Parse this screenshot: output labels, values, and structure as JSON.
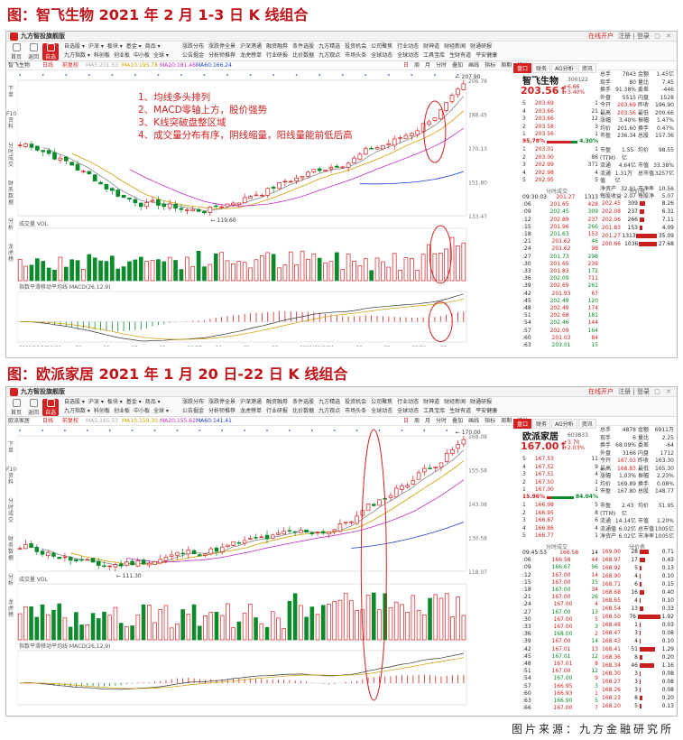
{
  "figures": [
    {
      "title": "图：智飞生物 2021 年 2 月 1-3 日 K 线组合",
      "app": {
        "name": "九方智投旗舰版",
        "open_account": "在线开户",
        "user": "注册 | 登录"
      },
      "toolbar": {
        "buttons": [
          "首页",
          "返回",
          "自选"
        ],
        "menus1": [
          "自选股 ▾",
          "沪深 ▾",
          "板块 ▾",
          "基金 ▾",
          "商品 ▾"
        ],
        "menus2": [
          "九方指数 ▾",
          "科创板",
          "创业板",
          "中小板",
          "全球 ▾"
        ],
        "menus3a": [
          "涨跌分布",
          "涨跌停全景",
          "沪深港通",
          "融资融券",
          "条件选股",
          "九方精选",
          "投资机会",
          "公司聚焦",
          "行业动态",
          "财神道",
          "财经新闻",
          "财通研报"
        ],
        "menus3b": [
          "公告掘金",
          "分析师推荐",
          "龙虎榜单",
          "行业研报",
          "比价数据",
          "九方观点",
          "市场头条",
          "全球动态",
          "全球动态",
          "工具宝库",
          "生财有道",
          "平安健康"
        ]
      },
      "chartbar": {
        "name": "智飞生物",
        "period": "日线",
        "adjust": "前复权",
        "ma_text": "MA5:201.53",
        "ma10": "MA10:195.78",
        "ma20": "MA20:181.46",
        "ma60": "MA60:166.24",
        "tabs": [
          "日",
          "周",
          "月",
          "分时"
        ],
        "buttons": [
          "叠加",
          "画线",
          "指标",
          "周期",
          "统计"
        ]
      },
      "left_tabs": [
        "下单",
        "F10资料",
        "分时成交",
        "财务数据",
        "分析",
        "龙虎榜"
      ],
      "stock": {
        "name": "智飞生物",
        "code": "300122",
        "price": "203.56",
        "arrow": "↑",
        "change": "+6.66",
        "pct": "+3.40%"
      },
      "info": [
        [
          "总手",
          "7843",
          "金额",
          "1.45亿"
        ],
        [
          "现手",
          "80",
          "量比",
          "7.45"
        ],
        [
          "换手",
          "91.38%",
          "委差",
          "-446"
        ],
        [
          "外盘",
          "5515",
          "内盘",
          "1528"
        ],
        [
          "今开",
          "203.69",
          "昨收",
          "196.90"
        ],
        [
          "最高",
          "203.56",
          "最低",
          "200.66"
        ],
        [
          "涨幅",
          "3.40%",
          "振幅",
          "1.47%"
        ],
        [
          "均价",
          "201.60",
          "换手",
          "0.47%"
        ],
        [
          "市盈",
          "236.34",
          "总股",
          "157.36"
        ]
      ],
      "info2": [
        [
          "市盈(TTM)",
          "1.55亿",
          "均价",
          "98.55"
        ],
        [
          "流通",
          "4.64亿",
          "市值",
          "33.38%"
        ],
        [
          "流通值",
          "1.31万亿",
          "总市值",
          "3257亿"
        ],
        [
          "净资产",
          "32.91",
          "市净率",
          "10.56"
        ],
        [
          "每股收益",
          "2.07",
          "每股净",
          "5.07"
        ]
      ],
      "asks": [
        [
          "5",
          "203.69",
          "1"
        ],
        [
          "4",
          "203.66",
          "21"
        ],
        [
          "3",
          "203.66",
          "12"
        ],
        [
          "2",
          "203.58",
          "3"
        ],
        [
          "1",
          "203.56",
          "1"
        ]
      ],
      "depth": {
        "left": "95.78%",
        "right": "4.30%"
      },
      "bids": [
        [
          "1",
          "203.01",
          "1"
        ],
        [
          "2",
          "203.00",
          "86"
        ],
        [
          "3",
          "202.99",
          "371"
        ],
        [
          "4",
          "202.98",
          "4"
        ],
        [
          "5",
          "202.95",
          "5"
        ]
      ],
      "tape_header": {
        "time": "09:30:03",
        "price": "201.27",
        "vol": "1313"
      },
      "tape": [
        [
          "201.65",
          "428"
        ],
        [
          "202.45",
          "309"
        ],
        [
          "202.89",
          "237"
        ],
        [
          "201.96",
          "266"
        ],
        [
          "201.63",
          "153"
        ],
        [
          "201.62",
          "46"
        ],
        [
          "201.62",
          "98"
        ],
        [
          "201.73",
          "298"
        ],
        [
          "201.65",
          "239"
        ],
        [
          "201.83",
          "172"
        ],
        [
          "202.09",
          "711"
        ],
        [
          "202.69",
          "261"
        ],
        [
          "201.93",
          "67"
        ],
        [
          "202.49",
          "120"
        ],
        [
          "202.49",
          "174"
        ],
        [
          "202.68",
          "181"
        ],
        [
          "202.46",
          "144"
        ],
        [
          "202.09",
          "164"
        ],
        [
          "201.03",
          "84"
        ],
        [
          "203.01",
          "15"
        ]
      ],
      "flow": [
        [
          "202.45",
          "309",
          "8.26"
        ],
        [
          "202.08",
          "237",
          "6.31"
        ],
        [
          "202.06",
          "266",
          "7.11"
        ],
        [
          "201.83",
          "153",
          "4.09"
        ],
        [
          "201.27",
          "1313",
          "35.09"
        ],
        [
          "200.66",
          "1036",
          "27.68"
        ]
      ],
      "annotations": [
        "1、均线多头排列",
        "2、MACD零轴上方，股价强势",
        "3、K线突破盘整区域",
        "4、成交量分布有序，阴线缩量，阳线量能前低后高"
      ],
      "price_labels": {
        "high": "207.90",
        "low": "119.60"
      },
      "vol_label": "成交量 VOL",
      "macd_label": "指数平滑移动平均线 MACD(26,12,9)",
      "dates": [
        "2020/10/19",
        "11/02",
        "09",
        "16",
        "23",
        "30",
        "12/07",
        "14",
        "21",
        "28",
        "2021/01/04",
        "11",
        "18",
        "25",
        "02/01",
        "08"
      ]
    },
    {
      "title": "图：欧派家居 2021 年 1 月 20 日-22 日 K 线组合",
      "app": {
        "name": "九方智投旗舰版",
        "open_account": "在线开户",
        "user": "注册 | 登录"
      },
      "chartbar": {
        "name": "欧派家居",
        "period": "日线",
        "adjust": "前复权",
        "ma_text": "MA5:165.53",
        "ma10": "MA10:159.30",
        "ma20": "MA20:155.62",
        "ma60": "MA60:141.41",
        "tabs": [
          "日",
          "周",
          "月",
          "分时"
        ],
        "buttons": [
          "叠加",
          "画线",
          "指标",
          "周期",
          "统计"
        ]
      },
      "stock": {
        "name": "欧派家居",
        "code": "603833",
        "price": "167.00",
        "arrow": "↑",
        "change": "+3.70",
        "pct": "+2.03%"
      },
      "info": [
        [
          "总手",
          "4878",
          "金额",
          "6911万"
        ],
        [
          "现手",
          "6",
          "量比",
          "2.25"
        ],
        [
          "换手",
          "68.09%",
          "委差",
          "-64"
        ],
        [
          "外盘",
          "3166",
          "内盘",
          "1712"
        ],
        [
          "今开",
          "167.03",
          "昨收",
          "163.30"
        ],
        [
          "最高",
          "168.83",
          "最低",
          "165.30"
        ],
        [
          "涨幅",
          "1.03%",
          "振幅",
          "2.23%"
        ],
        [
          "均价",
          "169.89",
          "换手",
          "0.08%"
        ],
        [
          "市盈",
          "167.80",
          "总股",
          "148.77"
        ]
      ],
      "info2": [
        [
          "市盈(TTM)",
          "2.43亿",
          "均价",
          "51.95"
        ],
        [
          "流通",
          "14.14亿",
          "市值",
          "1.20%"
        ],
        [
          "流通值",
          "6.02亿",
          "总市值",
          "1005亿"
        ],
        [
          "净资产",
          "6.02亿",
          "市净率",
          "1005亿"
        ]
      ],
      "asks": [
        [
          "5",
          "167.53",
          "11"
        ],
        [
          "4",
          "167.52",
          "9"
        ],
        [
          "3",
          "167.51",
          "4"
        ],
        [
          "2",
          "167.50",
          "1"
        ],
        [
          "1",
          "167.00",
          "1"
        ]
      ],
      "depth": {
        "left": "15.96%",
        "right": "84.04%"
      },
      "bids": [
        [
          "1",
          "166.98",
          "5"
        ],
        [
          "2",
          "166.95",
          "8"
        ],
        [
          "3",
          "166.87",
          "6"
        ],
        [
          "4",
          "166.86",
          "4"
        ],
        [
          "5",
          "166.77",
          "1"
        ]
      ],
      "tape_header": {
        "time": "09:45:53",
        "price": "166.58",
        "vol": "14"
      },
      "tape": [
        [
          "166.58",
          "44"
        ],
        [
          "166.67",
          "96"
        ],
        [
          "167.00",
          "14"
        ],
        [
          "167.00",
          "15"
        ],
        [
          "167.00",
          "34"
        ],
        [
          "167.00",
          "26"
        ],
        [
          "167.00",
          "4"
        ],
        [
          "167.00",
          "13"
        ],
        [
          "167.00",
          "5"
        ],
        [
          "167.00",
          "3"
        ],
        [
          "168.00",
          "2"
        ],
        [
          "167.00",
          "14"
        ],
        [
          "167.01",
          "13"
        ],
        [
          "167.01",
          "12"
        ],
        [
          "167.01",
          "8"
        ],
        [
          "167.00",
          "12"
        ],
        [
          "167.00",
          "9"
        ],
        [
          "166.95",
          "3"
        ],
        [
          "166.93",
          "1"
        ],
        [
          "166.90",
          "5"
        ],
        [
          "167.00",
          "7"
        ]
      ],
      "flow": [
        [
          "169.00",
          "28",
          "0.71"
        ],
        [
          "168.97",
          "17",
          "0.43"
        ],
        [
          "168.92",
          "5",
          "0.13"
        ],
        [
          "168.90",
          "4",
          "0.10"
        ],
        [
          "168.71",
          "6",
          "0.15"
        ],
        [
          "168.68",
          "16",
          "0.40"
        ],
        [
          "168.65",
          "4",
          "0.10"
        ],
        [
          "168.54",
          "13",
          "0.33"
        ],
        [
          "168.50",
          "76",
          "1.92"
        ],
        [
          "168.48",
          "1",
          "0.03"
        ],
        [
          "168.47",
          "3",
          "0.08"
        ],
        [
          "168.43",
          "4",
          "0.10"
        ],
        [
          "168.41",
          "51",
          "1.29"
        ],
        [
          "168.36",
          "8",
          "0.20"
        ],
        [
          "168.34",
          "46",
          "1.16"
        ],
        [
          "168.30",
          "3",
          "0.08"
        ],
        [
          "168.27",
          "3",
          "0.08"
        ],
        [
          "168.26",
          "3",
          "0.08"
        ],
        [
          "168.23",
          "8",
          "0.20"
        ],
        [
          "168.20",
          "5",
          "0.13"
        ]
      ],
      "price_labels": {
        "high": "170.00",
        "low": "111.30"
      },
      "vol_label": "成交量 VOL",
      "macd_label": "指数平滑移动平均线 MACD(26,12,9)",
      "dates": [
        "2020/10/19",
        "11/02",
        "09",
        "16",
        "23",
        "30",
        "12/07",
        "14",
        "21",
        "28",
        "2021/01/04",
        "11",
        "18",
        "25",
        "02/01"
      ]
    }
  ],
  "source": "图片来源：九方金融研究所",
  "colors": {
    "up": "#d42020",
    "down": "#0a8a2a",
    "title": "#c0141a",
    "ellipse": "#d42020"
  }
}
